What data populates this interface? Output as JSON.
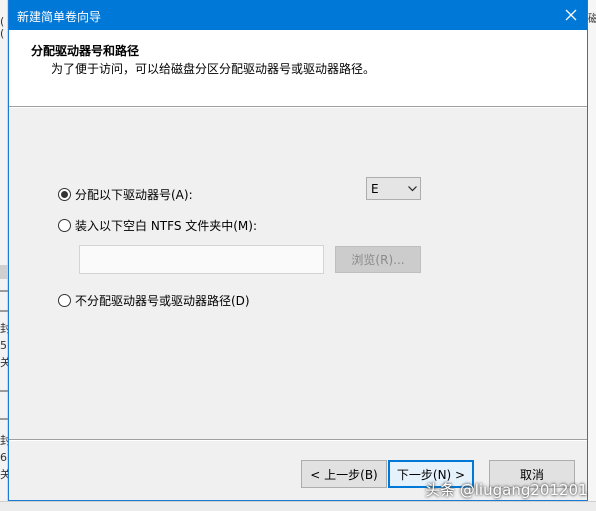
{
  "background": {
    "left_fragments": [
      "(",
      "(",
      "封",
      "5",
      "关",
      "封",
      "6",
      "关"
    ],
    "right_fragment": "磁"
  },
  "dialog": {
    "title": "新建简单卷向导",
    "header": {
      "heading": "分配驱动器号和路径",
      "description": "为了便于访问，可以给磁盘分区分配驱动器号或驱动器路径。"
    },
    "options": {
      "assign_letter": {
        "label": "分配以下驱动器号(A):",
        "checked": true
      },
      "mount_folder": {
        "label": "装入以下空白 NTFS 文件夹中(M):",
        "checked": false
      },
      "no_assign": {
        "label": "不分配驱动器号或驱动器路径(D)",
        "checked": false
      }
    },
    "drive_letter": {
      "value": "E"
    },
    "folder_path": {
      "value": "",
      "placeholder": ""
    },
    "browse_label": "浏览(R)...",
    "buttons": {
      "back": "< 上一步(B)",
      "next": "下一步(N) >",
      "cancel": "取消"
    }
  },
  "watermark": "头条 @liugang201201",
  "colors": {
    "titlebar": "#0078d7",
    "dialog_bg": "#f0f0f0",
    "header_bg": "#ffffff"
  }
}
